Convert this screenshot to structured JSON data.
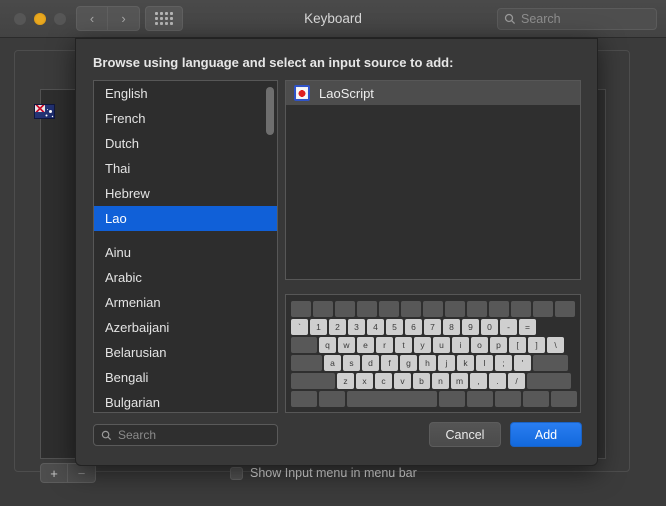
{
  "window": {
    "title": "Keyboard",
    "traffic_lights": [
      "close",
      "minimize",
      "zoom"
    ],
    "nav": {
      "back": "‹",
      "forward": "›"
    },
    "grid_icon": "grid-icon",
    "search": {
      "placeholder": "Search",
      "value": ""
    }
  },
  "background": {
    "add_button": "+",
    "remove_button": "−",
    "show_input_menu": {
      "label": "Show Input menu in menu bar",
      "checked": false
    }
  },
  "sheet": {
    "prompt": "Browse using language and select an input source to add:",
    "languages": {
      "recent": [
        "English",
        "French",
        "Dutch",
        "Thai",
        "Hebrew",
        "Lao"
      ],
      "all": [
        "Ainu",
        "Arabic",
        "Armenian",
        "Azerbaijani",
        "Belarusian",
        "Bengali",
        "Bulgarian"
      ],
      "selected": "Lao"
    },
    "input_sources": [
      {
        "name": "LaoScript",
        "icon": "lao-script-icon",
        "selected": true
      }
    ],
    "keyboard_preview": {
      "rows": [
        [
          "",
          "",
          "",
          "",
          "",
          "",
          "",
          "",
          "",
          "",
          "",
          "",
          ""
        ],
        [
          "`",
          "1",
          "2",
          "3",
          "4",
          "5",
          "6",
          "7",
          "8",
          "9",
          "0",
          "-",
          "="
        ],
        [
          "",
          "q",
          "w",
          "e",
          "r",
          "t",
          "y",
          "u",
          "i",
          "o",
          "p",
          "[",
          "]",
          "\\"
        ],
        [
          "",
          "a",
          "s",
          "d",
          "f",
          "g",
          "h",
          "j",
          "k",
          "l",
          ";",
          "'",
          ""
        ],
        [
          "",
          "z",
          "x",
          "c",
          "v",
          "b",
          "n",
          "m",
          ",",
          ".",
          "/",
          ""
        ],
        [
          "",
          "",
          "",
          "",
          "",
          "",
          "",
          ""
        ]
      ]
    },
    "search": {
      "placeholder": "Search",
      "value": ""
    },
    "cancel_button": "Cancel",
    "add_button": "Add"
  },
  "colors": {
    "accent": "#1060d8",
    "default_button": "#1269dd",
    "window_bg": "#3b3b3b",
    "sheet_bg": "#383838"
  }
}
